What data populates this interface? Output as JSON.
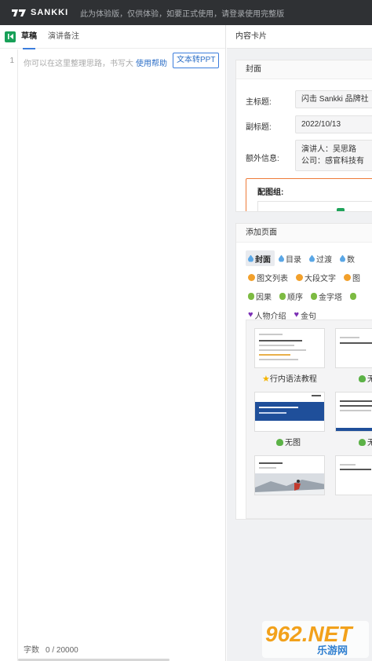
{
  "topbar": {
    "logo_text": "SANKKI",
    "notice": "此为体验版，仅供体验，如要正式使用，请登录使用完整版"
  },
  "left": {
    "tabs": [
      {
        "label": "草稿",
        "active": true
      },
      {
        "label": "演讲备注",
        "active": false
      }
    ],
    "line_number": "1",
    "placeholder": "你可以在这里整理思路，书写大",
    "help_link": "使用帮助",
    "convert_button": "文本转PPT",
    "wordcount_label": "字数",
    "wordcount_value": "0 / 20000"
  },
  "right": {
    "header": "内容卡片",
    "cover": {
      "title": "封面",
      "main_title_label": "主标题:",
      "main_title_value": "闪击 Sankki 品牌社",
      "subtitle_label": "副标题:",
      "subtitle_value": "2022/10/13",
      "extra_label": "额外信息:",
      "extra_lines": [
        "演讲人：吴思路",
        "公司：感官科技有"
      ],
      "image_group_label": "配图组:"
    },
    "add_page": {
      "title": "添加页面",
      "tag_rows": [
        [
          {
            "label": "封面",
            "icon": "drop-icon",
            "active": true
          },
          {
            "label": "目录",
            "icon": "drop-icon",
            "active": false
          },
          {
            "label": "过渡",
            "icon": "drop-icon",
            "active": false
          },
          {
            "label": "数",
            "icon": "drop-icon",
            "active": false
          }
        ],
        [
          {
            "label": "图文列表",
            "icon": "orange-icon",
            "active": false
          },
          {
            "label": "大段文字",
            "icon": "orange-icon",
            "active": false
          },
          {
            "label": "图",
            "icon": "orange-icon",
            "active": false
          }
        ],
        [
          {
            "label": "因果",
            "icon": "pear-icon",
            "active": false
          },
          {
            "label": "顺序",
            "icon": "pear-icon",
            "active": false
          },
          {
            "label": "金字塔",
            "icon": "pear-icon",
            "active": false
          },
          {
            "label": "",
            "icon": "pear-icon",
            "active": false
          }
        ],
        [
          {
            "label": "人物介绍",
            "icon": "heart-icon",
            "active": false
          },
          {
            "label": "金句",
            "icon": "heart-icon",
            "active": false
          }
        ]
      ],
      "templates": [
        {
          "caption": "行内语法教程",
          "badge": "star-icon"
        },
        {
          "caption": "无",
          "badge": "frog-icon"
        },
        {
          "caption": "无图",
          "badge": "frog-icon"
        },
        {
          "caption": "无",
          "badge": "frog-icon"
        },
        {
          "caption": "",
          "badge": ""
        },
        {
          "caption": "",
          "badge": ""
        }
      ]
    }
  },
  "watermark": {
    "main": "962.NET",
    "sub": "乐游网"
  },
  "colors": {
    "topbar": "#2f3134",
    "accent_green": "#18a058",
    "link_blue": "#2d6fc7",
    "image_group_border": "#ee7b38"
  }
}
